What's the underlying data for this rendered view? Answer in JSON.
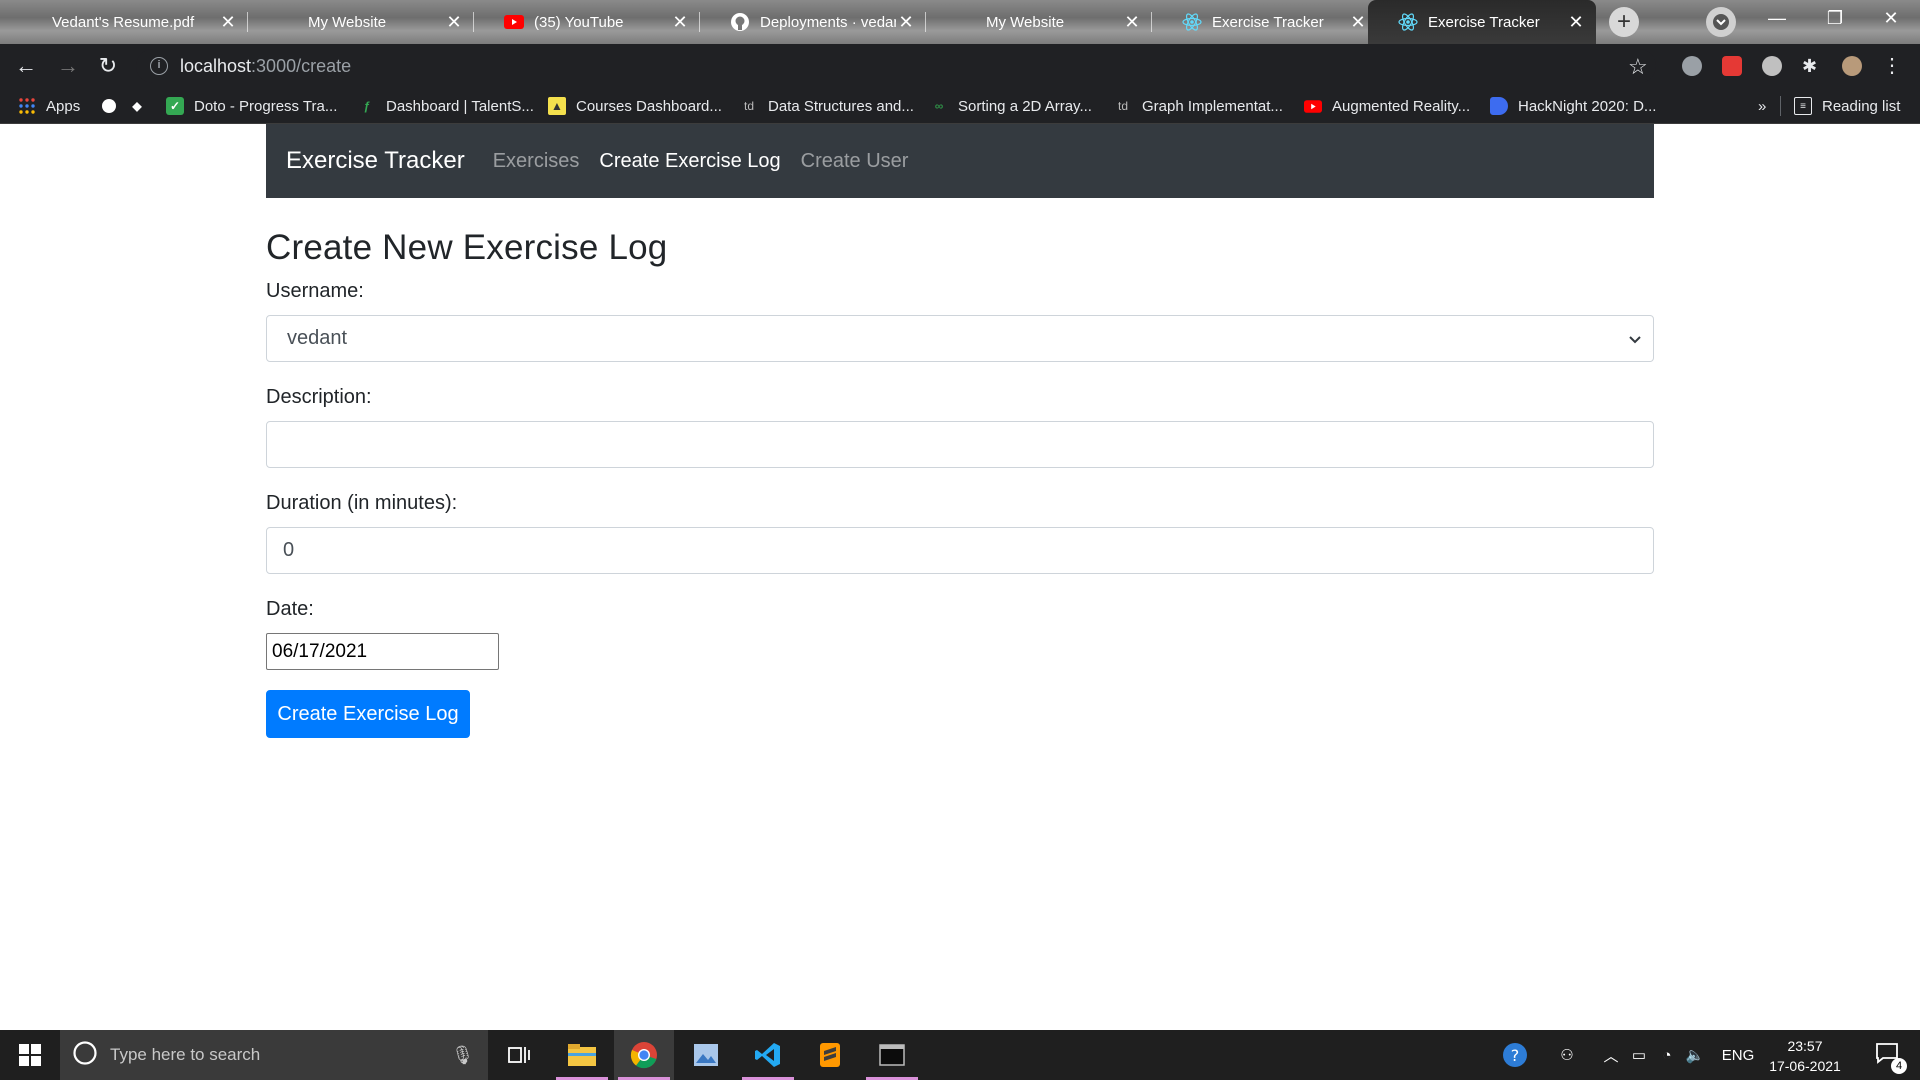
{
  "browser": {
    "tabs": [
      {
        "title": "Vedant's Resume.pdf",
        "icon": "pdf-icon"
      },
      {
        "title": "My Website",
        "icon": "globe-icon"
      },
      {
        "title": "(35) YouTube",
        "icon": "youtube-icon"
      },
      {
        "title": "Deployments · vedant",
        "icon": "github-icon"
      },
      {
        "title": "My Website",
        "icon": "globe-icon"
      },
      {
        "title": "Exercise Tracker",
        "icon": "react-icon"
      },
      {
        "title": "Exercise Tracker",
        "icon": "react-icon",
        "active": true
      }
    ],
    "url_host": "localhost",
    "url_path": ":3000/create",
    "bookmarks": [
      {
        "label": "Apps",
        "icon": "apps-grid-icon"
      },
      {
        "label": "Doto - Progress Tra...",
        "icon": "check-icon"
      },
      {
        "label": "Dashboard | TalentS...",
        "icon": "leaf-icon"
      },
      {
        "label": "Courses Dashboard...",
        "icon": "course-icon"
      },
      {
        "label": "Data Structures and...",
        "icon": "td-icon"
      },
      {
        "label": "Sorting a 2D Array...",
        "icon": "gfg-icon"
      },
      {
        "label": "Graph Implementat...",
        "icon": "td-icon"
      },
      {
        "label": "Augmented Reality...",
        "icon": "youtube-icon"
      },
      {
        "label": "HackNight 2020: D...",
        "icon": "bookmark-blue-icon"
      }
    ],
    "reading_list_label": "Reading list",
    "more_bookmarks": "»"
  },
  "app": {
    "brand": "Exercise Tracker",
    "nav": [
      {
        "label": "Exercises",
        "active": false
      },
      {
        "label": "Create Exercise Log",
        "active": true
      },
      {
        "label": "Create User",
        "active": false
      }
    ]
  },
  "form": {
    "heading": "Create New Exercise Log",
    "username_label": "Username:",
    "username_value": "vedant",
    "description_label": "Description:",
    "description_value": "",
    "duration_label": "Duration (in minutes):",
    "duration_value": "0",
    "date_label": "Date:",
    "date_value": "06/17/2021",
    "submit_label": "Create Exercise Log"
  },
  "taskbar": {
    "search_placeholder": "Type here to search",
    "language": "ENG",
    "time": "23:57",
    "date": "17-06-2021",
    "notification_count": "4"
  },
  "colors": {
    "navbar_bg": "#343a40",
    "primary": "#007bff",
    "chrome_dark": "#202124"
  }
}
